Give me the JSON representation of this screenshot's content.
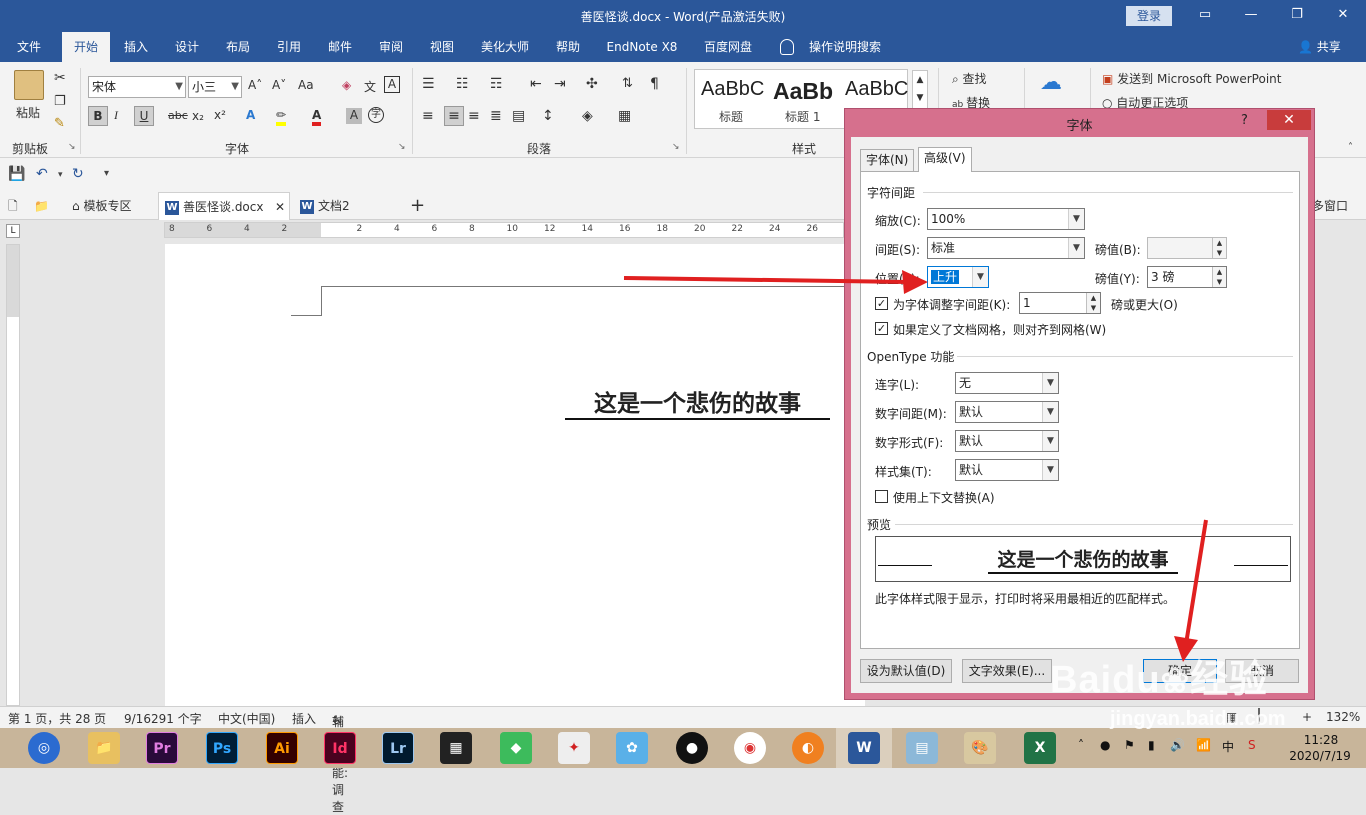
{
  "window": {
    "title": "善医怪谈.docx  -  Word(产品激活失败)",
    "login_label": "登录",
    "min_glyph": "—",
    "max_glyph": "❐",
    "close_glyph": "✕",
    "ribbon_display_glyph": "▭"
  },
  "menu": {
    "tabs": [
      "文件",
      "开始",
      "插入",
      "设计",
      "布局",
      "引用",
      "邮件",
      "审阅",
      "视图",
      "美化大师",
      "帮助",
      "EndNote X8",
      "百度网盘",
      "操作说明搜索"
    ],
    "active": "开始",
    "share_label": "共享"
  },
  "ribbon": {
    "clipboard": {
      "paste_label": "粘贴",
      "group_label": "剪贴板"
    },
    "font": {
      "font_name": "宋体",
      "font_size": "小三",
      "grow": "A˄",
      "shrink": "A˅",
      "case": "Aa",
      "bold": "B",
      "italic": "I",
      "underline": "U",
      "strike": "abc",
      "sub": "x₂",
      "sup": "x²",
      "group_label": "字体"
    },
    "paragraph": {
      "group_label": "段落"
    },
    "styles": {
      "items": [
        {
          "sample": "AaBbC",
          "label": "标题"
        },
        {
          "sample": "AaBb",
          "label": "标题 1"
        },
        {
          "sample": "AaBbC",
          "label": ""
        }
      ],
      "group_label": "样式"
    },
    "editing": {
      "find_label": "查找",
      "replace_label": "替换"
    },
    "extra": {
      "send_to_ppt": "发送到 Microsoft PowerPoint",
      "autocorrect": "自动更正选项"
    }
  },
  "doc_tabs": {
    "items": [
      "模板专区",
      "善医怪谈.docx",
      "文档2"
    ],
    "active": "善医怪谈.docx",
    "new_tab": "+",
    "right_label": "多窗口"
  },
  "ruler": {
    "ticks": [
      "8",
      "6",
      "4",
      "2",
      "",
      "2",
      "4",
      "6",
      "8",
      "10",
      "12",
      "14",
      "16",
      "18",
      "20",
      "22",
      "24",
      "26",
      "28"
    ]
  },
  "document": {
    "heading": "这是一个悲伤的故事"
  },
  "status": {
    "page": "第 1 页，共 28 页",
    "words": "9/16291 个字",
    "language": "中文(中国)",
    "mode": "插入",
    "accessibility": "辅助功能: 调查",
    "zoom": "132%"
  },
  "dialog": {
    "title": "字体",
    "help": "?",
    "close": "✕",
    "tabs": [
      "字体(N)",
      "高级(V)"
    ],
    "active_tab": "高级(V)",
    "spacing_section": "字符间距",
    "scale_label": "缩放(C):",
    "scale_value": "100%",
    "spacing_label": "间距(S):",
    "spacing_value": "标准",
    "spacing_pt_label": "磅值(B):",
    "spacing_pt_value": "",
    "position_label": "位置(P):",
    "position_value": "上升",
    "position_pt_label": "磅值(Y):",
    "position_pt_value": "3 磅",
    "kerning_label": "为字体调整字间距(K):",
    "kerning_value": "1",
    "kerning_suffix": "磅或更大(O)",
    "kerning_checked": true,
    "grid_label": "如果定义了文档网格，则对齐到网格(W)",
    "grid_checked": true,
    "opentype_section": "OpenType 功能",
    "ligatures_label": "连字(L):",
    "ligatures_value": "无",
    "num_spacing_label": "数字间距(M):",
    "num_spacing_value": "默认",
    "num_forms_label": "数字形式(F):",
    "num_forms_value": "默认",
    "stylistic_label": "样式集(T):",
    "stylistic_value": "默认",
    "contextual_label": "使用上下文替换(A)",
    "contextual_checked": false,
    "preview_section": "预览",
    "preview_text": "这是一个悲伤的故事",
    "preview_note": "此字体样式限于显示，打印时将采用最相近的匹配样式。",
    "btn_default": "设为默认值(D)",
    "btn_effects": "文字效果(E)...",
    "btn_ok": "确定",
    "btn_cancel": "取消"
  },
  "taskbar": {
    "apps": [
      "Pr",
      "Ps",
      "Ai",
      "Id",
      "Lr",
      "W",
      "X"
    ],
    "time": "11:28",
    "date": "2020/7/19",
    "ime": "中"
  },
  "watermark": {
    "brand": "Baidu",
    "cn": "经验",
    "url": "jingyan.baidu.com"
  },
  "colors": {
    "word_blue": "#2b579a",
    "dialog_frame": "#d6708d",
    "arrow_red": "#e02020",
    "selection": "#0078d7"
  }
}
